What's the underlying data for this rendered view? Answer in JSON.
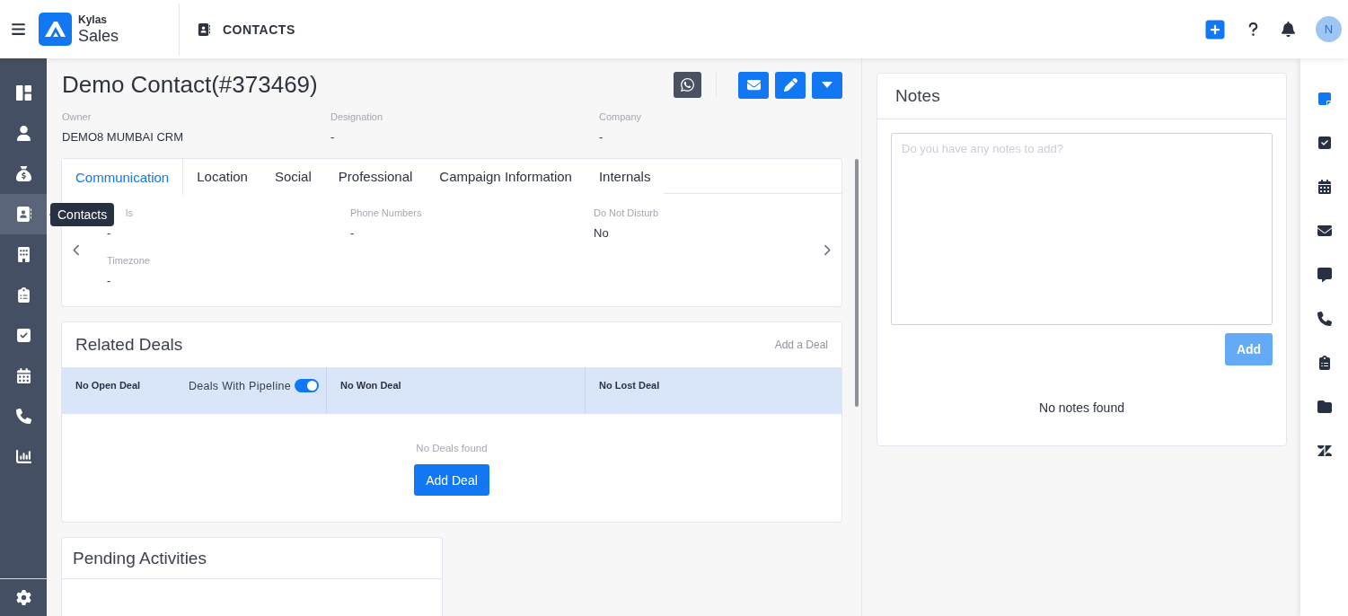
{
  "header": {
    "brand_top": "Kylas",
    "brand_bottom": "Sales",
    "module": "CONTACTS",
    "avatar": "N"
  },
  "sidebar": {
    "items": [
      {
        "selected": false
      },
      {
        "selected": false
      },
      {
        "selected": false
      },
      {
        "selected": true
      },
      {
        "selected": false
      },
      {
        "selected": false
      },
      {
        "selected": false
      },
      {
        "selected": false
      },
      {
        "selected": false
      },
      {
        "selected": false
      }
    ],
    "tooltip": "Contacts"
  },
  "contact": {
    "title": "Demo Contact(#373469)",
    "summary": [
      {
        "label": "Owner",
        "value": "DEMO8 MUMBAI CRM"
      },
      {
        "label": "Designation",
        "value": "-"
      },
      {
        "label": "Company",
        "value": "-"
      }
    ]
  },
  "tabs": [
    {
      "label": "Communication",
      "selected": true
    },
    {
      "label": "Location",
      "selected": false
    },
    {
      "label": "Social",
      "selected": false
    },
    {
      "label": "Professional",
      "selected": false
    },
    {
      "label": "Campaign Information",
      "selected": false
    },
    {
      "label": "Internals",
      "selected": false
    }
  ],
  "communication_fields": [
    {
      "label": "ls",
      "value": "-"
    },
    {
      "label": "Phone Numbers",
      "value": "-"
    },
    {
      "label": "Do Not Disturb",
      "value": "No"
    },
    {
      "label": "Timezone",
      "value": "-"
    }
  ],
  "related_deals": {
    "title": "Related Deals",
    "link": "Add a Deal",
    "columns": [
      {
        "label": "No Open Deal"
      },
      {
        "label": "No Won Deal"
      },
      {
        "label": "No Lost Deal"
      }
    ],
    "pipeline_toggle": {
      "label": "Deals With Pipeline",
      "on": true
    },
    "empty": "No Deals found",
    "button": "Add Deal"
  },
  "pending_activities": {
    "title": "Pending Activities"
  },
  "notes": {
    "title": "Notes",
    "placeholder": "Do you have any notes to add?",
    "button": "Add",
    "empty": "No notes found"
  },
  "right_rail": {
    "items": [
      {
        "selected": true
      },
      {
        "selected": false
      },
      {
        "selected": false
      },
      {
        "selected": false
      },
      {
        "selected": false
      },
      {
        "selected": false
      },
      {
        "selected": false
      },
      {
        "selected": false
      },
      {
        "selected": false
      }
    ]
  }
}
